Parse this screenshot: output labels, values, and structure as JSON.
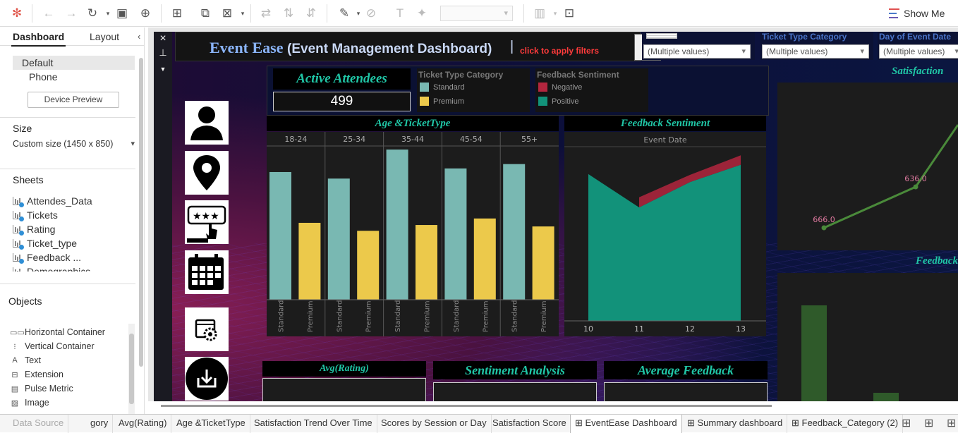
{
  "toolbar": {
    "show_me_label": "Show Me"
  },
  "left_panel": {
    "tabs": {
      "dashboard": "Dashboard",
      "layout": "Layout"
    },
    "devices": {
      "default": "Default",
      "phone": "Phone",
      "preview_button": "Device Preview"
    },
    "size": {
      "title": "Size",
      "value": "Custom size (1450 x 850)"
    },
    "sheets": {
      "title": "Sheets",
      "items": [
        "Attendes_Data",
        "Tickets",
        "Rating",
        "Ticket_type",
        "Feedback ...",
        "Demographics"
      ]
    },
    "objects": {
      "title": "Objects",
      "items": [
        "Horizontal Container",
        "Vertical Container",
        "Text",
        "Extension",
        "Pulse Metric",
        "Image"
      ]
    }
  },
  "dashboard": {
    "title_main": "Event Ease",
    "title_sub": "(Event Management Dashboard)",
    "title_pipe": "|",
    "click_hint": "click to apply filters",
    "filters": [
      {
        "label": "",
        "value": "(Multiple values)"
      },
      {
        "label": "Ticket Type Category",
        "value": "(Multiple values)"
      },
      {
        "label": "Day of Event Date",
        "value": "(Multiple values)"
      }
    ],
    "kpi": {
      "title": "Active Attendees",
      "value": "499"
    },
    "legend_ticket": {
      "title": "Ticket Type Category",
      "items": [
        {
          "label": "Standard",
          "color": "#79b8b2"
        },
        {
          "label": "Premium",
          "color": "#ecc94b"
        }
      ]
    },
    "legend_feedback": {
      "title": "Feedback Sentiment",
      "items": [
        {
          "label": "Negative",
          "color": "#b3263e"
        },
        {
          "label": "Positive",
          "color": "#12927a"
        }
      ]
    },
    "panels": {
      "age_ticket": "Age &TicketType",
      "feedback_sentiment": "Feedback Sentiment",
      "satisfaction": "Satisfaction",
      "feedback_right": "Feedback",
      "avg_rating": "Avg(Rating)",
      "sentiment_analysis": "Sentiment Analysis",
      "average_feedback": "Average Feedback"
    },
    "feedback_axis_title": "Event Date"
  },
  "chart_data": [
    {
      "type": "bar",
      "title": "Age &TicketType",
      "categories": [
        "18-24",
        "25-34",
        "35-44",
        "45-54",
        "55+"
      ],
      "sub_categories": [
        "Standard",
        "Premium"
      ],
      "series": [
        {
          "name": "Standard",
          "color": "#79b8b2",
          "values": [
            176,
            167,
            207,
            181,
            187
          ]
        },
        {
          "name": "Premium",
          "color": "#ecc94b",
          "values": [
            106,
            95,
            103,
            112,
            101
          ]
        }
      ]
    },
    {
      "type": "area",
      "title": "Feedback Sentiment",
      "xlabel": "Event Date",
      "x": [
        10,
        11,
        12,
        13
      ],
      "series": [
        {
          "name": "Positive",
          "color": "#12927a",
          "values": [
            203,
            157,
            192,
            216
          ]
        },
        {
          "name": "Negative",
          "color": "#b3263e",
          "values": [
            null,
            14,
            10,
            13
          ]
        }
      ]
    },
    {
      "type": "line",
      "title": "Satisfaction",
      "series": [
        {
          "name": "",
          "color": "#4a8a3a",
          "values": [
            666.0,
            636.0
          ],
          "labels": [
            "666.0",
            "636.0"
          ]
        }
      ]
    }
  ],
  "bottom_tabs": [
    {
      "label": "Data Source",
      "active": false
    },
    {
      "label": "gory",
      "active": false
    },
    {
      "label": "Avg(Rating)",
      "active": false
    },
    {
      "label": "Age &TicketType",
      "active": false
    },
    {
      "label": "Satisfaction Trend Over Time",
      "active": false
    },
    {
      "label": "Scores by Session or Day",
      "active": false
    },
    {
      "label": "Satisfaction Score",
      "active": false
    },
    {
      "label": "EventEase Dashboard",
      "active": true
    },
    {
      "label": "Summary dashboard",
      "active": false
    },
    {
      "label": "Feedback_Category (2)",
      "active": false
    }
  ]
}
